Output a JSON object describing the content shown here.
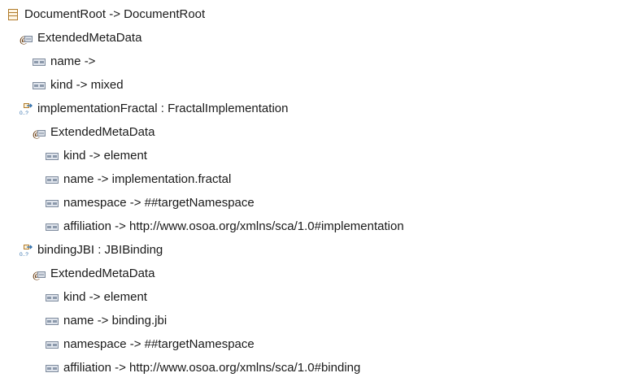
{
  "tree": [
    {
      "label": "DocumentRoot -> DocumentRoot",
      "icon": "class-icon",
      "depth": 0
    },
    {
      "label": "ExtendedMetaData",
      "icon": "annotation-icon",
      "depth": 1
    },
    {
      "label": "name -> ",
      "icon": "detail-entry-icon",
      "depth": 2
    },
    {
      "label": "kind -> mixed",
      "icon": "detail-entry-icon",
      "depth": 2
    },
    {
      "label": "implementationFractal : FractalImplementation",
      "icon": "reference-icon",
      "depth": 1
    },
    {
      "label": "ExtendedMetaData",
      "icon": "annotation-icon",
      "depth": 2
    },
    {
      "label": "kind -> element",
      "icon": "detail-entry-icon",
      "depth": 3
    },
    {
      "label": "name -> implementation.fractal",
      "icon": "detail-entry-icon",
      "depth": 3
    },
    {
      "label": "namespace -> ##targetNamespace",
      "icon": "detail-entry-icon",
      "depth": 3
    },
    {
      "label": "affiliation -> http://www.osoa.org/xmlns/sca/1.0#implementation",
      "icon": "detail-entry-icon",
      "depth": 3
    },
    {
      "label": "bindingJBI : JBIBinding",
      "icon": "reference-icon",
      "depth": 1
    },
    {
      "label": "ExtendedMetaData",
      "icon": "annotation-icon",
      "depth": 2
    },
    {
      "label": "kind -> element",
      "icon": "detail-entry-icon",
      "depth": 3
    },
    {
      "label": "name -> binding.jbi",
      "icon": "detail-entry-icon",
      "depth": 3
    },
    {
      "label": "namespace -> ##targetNamespace",
      "icon": "detail-entry-icon",
      "depth": 3
    },
    {
      "label": "affiliation -> http://www.osoa.org/xmlns/sca/1.0#binding",
      "icon": "detail-entry-icon",
      "depth": 3
    }
  ]
}
